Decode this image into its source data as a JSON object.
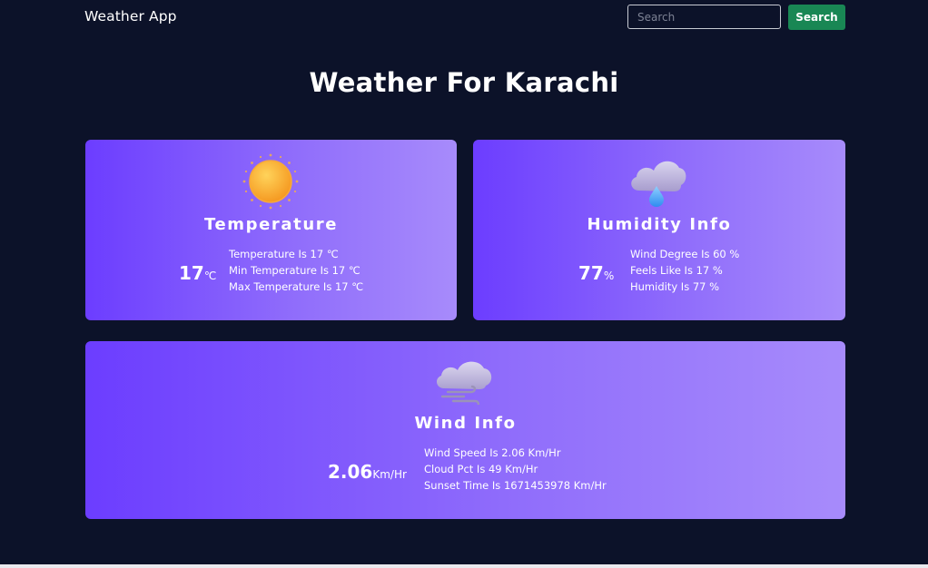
{
  "navbar": {
    "brand": "Weather App",
    "search_placeholder": "Search",
    "search_value": "",
    "search_button": "Search"
  },
  "page": {
    "title": "Weather For Karachi"
  },
  "colors": {
    "background": "#0c1229",
    "search_button": "#198754",
    "card_gradient_start": "#6c3dff",
    "card_gradient_end": "#a78bfb"
  },
  "temperature_card": {
    "icon": "sun-icon",
    "title": "Temperature",
    "value": "17",
    "unit": "℃",
    "details": [
      "Temperature Is 17 ℃",
      "Min Temperature Is 17 ℃",
      "Max Temperature Is 17 ℃"
    ]
  },
  "humidity_card": {
    "icon": "cloud-rain-icon",
    "title": "Humidity Info",
    "value": "77",
    "unit": "%",
    "details": [
      "Wind Degree Is 60 %",
      "Feels Like Is 17 %",
      "Humidity Is 77 %"
    ]
  },
  "wind_card": {
    "icon": "cloud-wind-icon",
    "title": "Wind Info",
    "value": "2.06",
    "unit": "Km/Hr",
    "details": [
      "Wind Speed Is 2.06 Km/Hr",
      "Cloud Pct Is 49 Km/Hr",
      "Sunset Time Is 1671453978 Km/Hr"
    ]
  }
}
